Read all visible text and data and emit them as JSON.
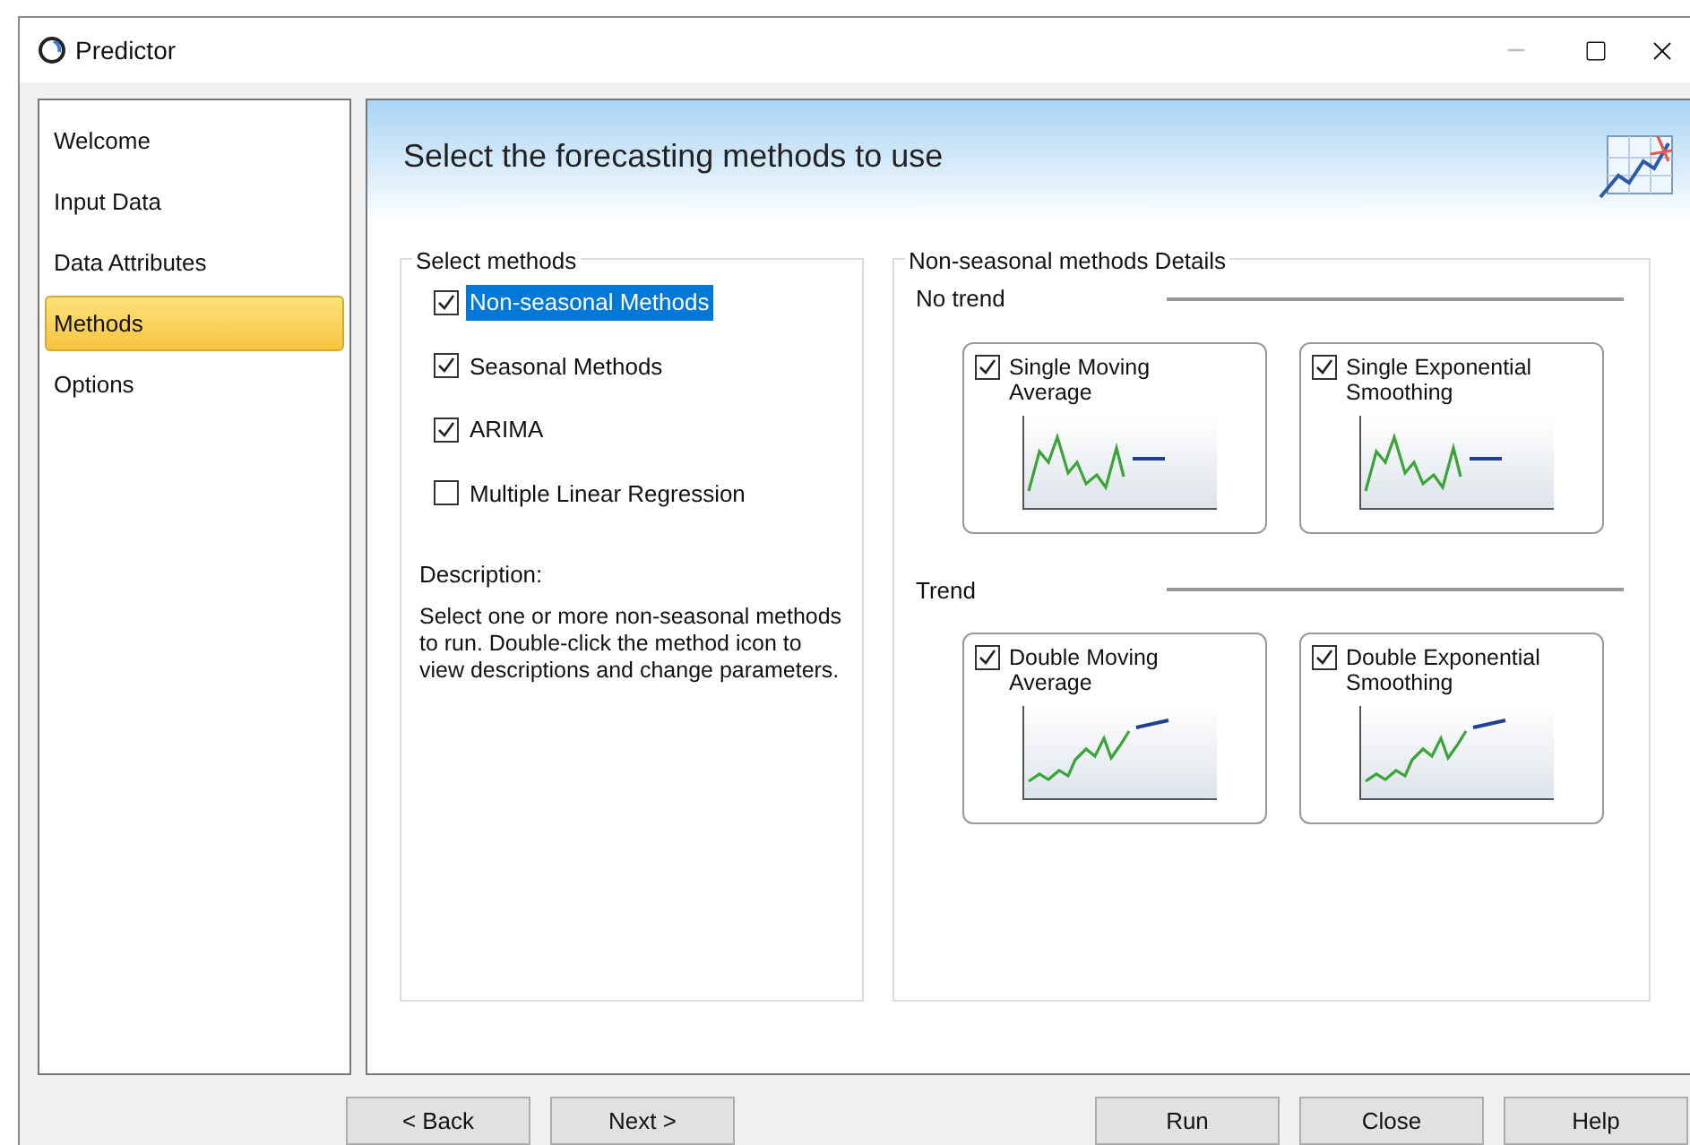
{
  "window": {
    "title": "Predictor"
  },
  "sidebar": {
    "items": [
      {
        "label": "Welcome",
        "selected": false
      },
      {
        "label": "Input Data",
        "selected": false
      },
      {
        "label": "Data Attributes",
        "selected": false
      },
      {
        "label": "Methods",
        "selected": true
      },
      {
        "label": "Options",
        "selected": false
      }
    ]
  },
  "header": {
    "title": "Select the forecasting methods to use"
  },
  "select_methods": {
    "title": "Select methods",
    "options": [
      {
        "label": "Non-seasonal Methods",
        "checked": true,
        "selected": true
      },
      {
        "label": "Seasonal Methods",
        "checked": true,
        "selected": false
      },
      {
        "label": "ARIMA",
        "checked": true,
        "selected": false
      },
      {
        "label": "Multiple Linear Regression",
        "checked": false,
        "selected": false
      }
    ],
    "description_label": "Description:",
    "description": "Select one or more non-seasonal methods to run.  Double-click the method icon to view descriptions and change parameters."
  },
  "details": {
    "title": "Non-seasonal methods Details",
    "groups": [
      {
        "label": "No trend",
        "kind": "flat",
        "methods": [
          {
            "label": "Single Moving Average",
            "checked": true
          },
          {
            "label": "Single Exponential Smoothing",
            "checked": true
          }
        ]
      },
      {
        "label": "Trend",
        "kind": "trend",
        "methods": [
          {
            "label": "Double Moving Average",
            "checked": true
          },
          {
            "label": "Double Exponential Smoothing",
            "checked": true
          }
        ]
      }
    ]
  },
  "buttons": {
    "left": [
      "< Back",
      "Next >"
    ],
    "right": [
      "Run",
      "Close",
      "Help"
    ]
  }
}
